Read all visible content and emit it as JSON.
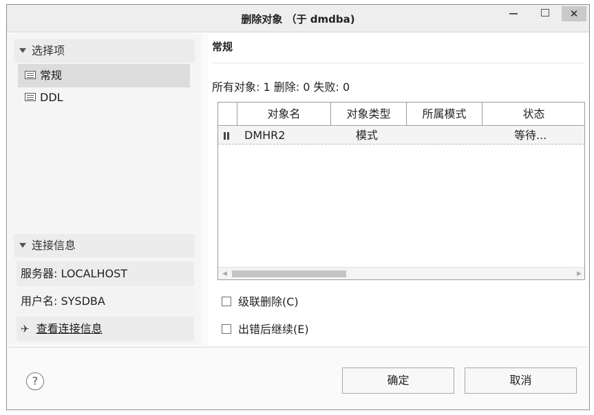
{
  "window": {
    "title": "删除对象 （于 dmdba)",
    "minimize_glyph": "",
    "close_glyph": "✕"
  },
  "left": {
    "options_header": "选择项",
    "options": [
      {
        "label": "常规",
        "icon": "list-icon",
        "selected": true
      },
      {
        "label": "DDL",
        "icon": "list-icon",
        "selected": false
      }
    ],
    "connection_header": "连接信息",
    "server": "服务器: LOCALHOST",
    "user": "用户名: SYSDBA",
    "view_connection_link": "查看连接信息",
    "view_connection_icon": "connection-icon"
  },
  "main": {
    "section_title": "常规",
    "summary": "所有对象: 1 删除: 0 失败: 0",
    "table": {
      "columns": [
        "对象名",
        "对象类型",
        "所属模式",
        "状态"
      ],
      "rows": [
        {
          "status_icon": "pause-icon",
          "name": "DMHR2",
          "type": "模式",
          "schema": "",
          "state": "等待..."
        }
      ]
    },
    "cascade_delete_label": "级联删除(C)",
    "cascade_delete_checked": false,
    "continue_on_error_label": "出错后继续(E)",
    "continue_on_error_checked": false
  },
  "footer": {
    "help_glyph": "?",
    "ok_label": "确定",
    "cancel_label": "取消"
  }
}
